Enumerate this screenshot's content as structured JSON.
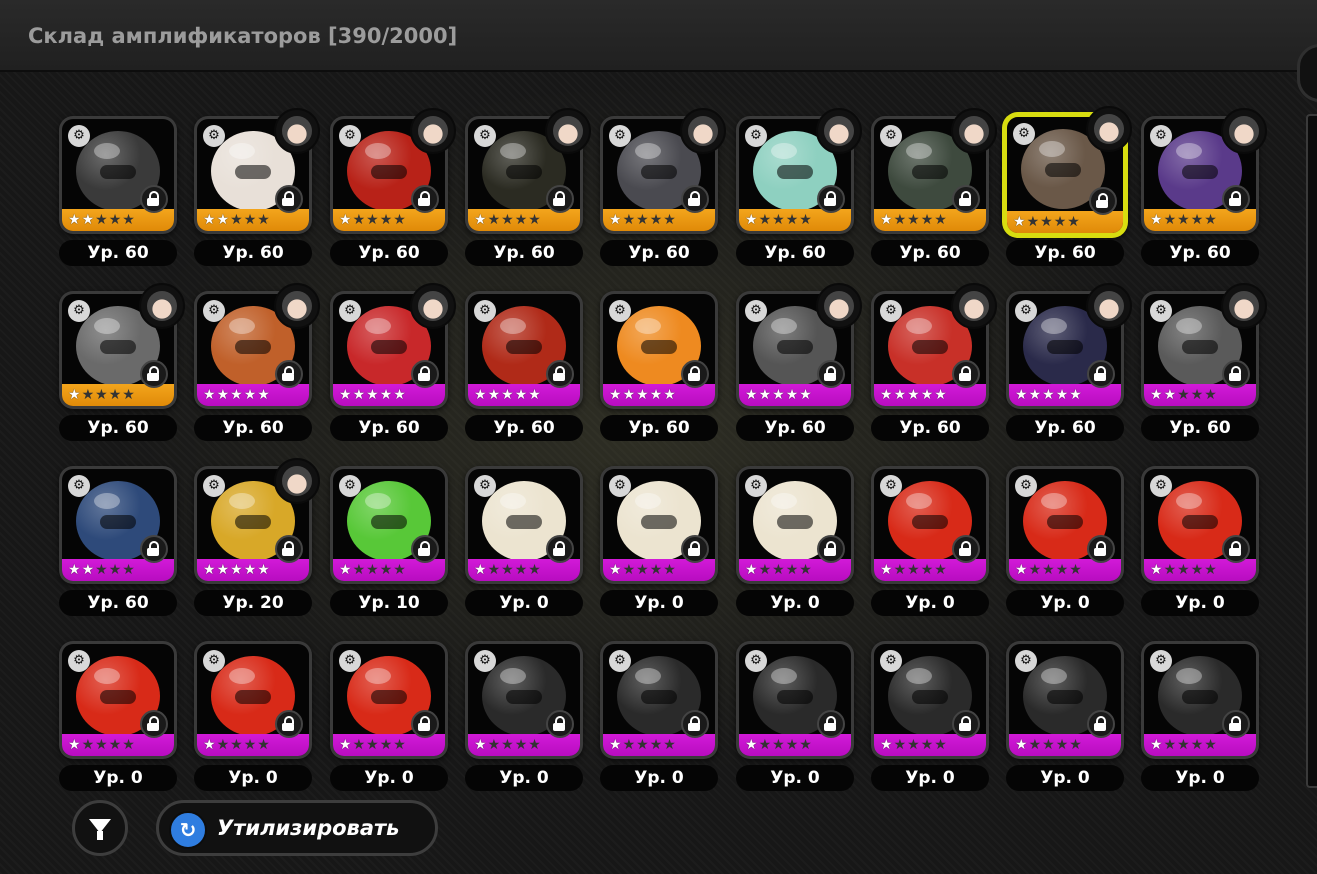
{
  "window": {
    "title": "Склад амплификаторов [390/2000]"
  },
  "grid": {
    "rows": [
      [
        {
          "level": "Ур. 60",
          "stars": 2,
          "rarity": "A",
          "portrait": false,
          "color": "#3a3a3a",
          "selected": false
        },
        {
          "level": "Ур. 60",
          "stars": 2,
          "rarity": "A",
          "portrait": true,
          "color": "#e8e0d8",
          "selected": false
        },
        {
          "level": "Ур. 60",
          "stars": 1,
          "rarity": "A",
          "portrait": true,
          "color": "#b82218",
          "selected": false
        },
        {
          "level": "Ур. 60",
          "stars": 1,
          "rarity": "A",
          "portrait": true,
          "color": "#2b2b22",
          "selected": false
        },
        {
          "level": "Ур. 60",
          "stars": 1,
          "rarity": "A",
          "portrait": true,
          "color": "#4a4a50",
          "selected": false
        },
        {
          "level": "Ур. 60",
          "stars": 1,
          "rarity": "A",
          "portrait": true,
          "color": "#8ed0c0",
          "selected": false
        },
        {
          "level": "Ур. 60",
          "stars": 1,
          "rarity": "A",
          "portrait": true,
          "color": "#3e4a3e",
          "selected": false
        },
        {
          "level": "Ур. 60",
          "stars": 1,
          "rarity": "A",
          "portrait": true,
          "color": "#6a5848",
          "selected": true
        },
        {
          "level": "Ур. 60",
          "stars": 1,
          "rarity": "A",
          "portrait": true,
          "color": "#5a3a8a",
          "selected": false
        }
      ],
      [
        {
          "level": "Ур. 60",
          "stars": 1,
          "rarity": "A",
          "portrait": true,
          "color": "#6a6a6a",
          "selected": false
        },
        {
          "level": "Ур. 60",
          "stars": 5,
          "rarity": "S",
          "portrait": true,
          "color": "#c0602a",
          "selected": false
        },
        {
          "level": "Ур. 60",
          "stars": 5,
          "rarity": "S",
          "portrait": true,
          "color": "#c8282a",
          "selected": false
        },
        {
          "level": "Ур. 60",
          "stars": 5,
          "rarity": "S",
          "portrait": false,
          "color": "#b02a18",
          "selected": false
        },
        {
          "level": "Ур. 60",
          "stars": 5,
          "rarity": "S",
          "portrait": false,
          "color": "#ee8a20",
          "selected": false
        },
        {
          "level": "Ур. 60",
          "stars": 5,
          "rarity": "S",
          "portrait": true,
          "color": "#555555",
          "selected": false
        },
        {
          "level": "Ур. 60",
          "stars": 5,
          "rarity": "S",
          "portrait": true,
          "color": "#c83028",
          "selected": false
        },
        {
          "level": "Ур. 60",
          "stars": 5,
          "rarity": "S",
          "portrait": true,
          "color": "#2a2a4a",
          "selected": false
        },
        {
          "level": "Ур. 60",
          "stars": 2,
          "rarity": "S",
          "portrait": true,
          "color": "#5a5a5a",
          "selected": false
        }
      ],
      [
        {
          "level": "Ур. 60",
          "stars": 2,
          "rarity": "S",
          "portrait": false,
          "color": "#2e4a7a",
          "selected": false
        },
        {
          "level": "Ур. 20",
          "stars": 5,
          "rarity": "S",
          "portrait": true,
          "color": "#d8a828",
          "selected": false
        },
        {
          "level": "Ур. 10",
          "stars": 1,
          "rarity": "S",
          "portrait": false,
          "color": "#58c838",
          "selected": false
        },
        {
          "level": "Ур. 0",
          "stars": 1,
          "rarity": "S",
          "portrait": false,
          "color": "#ece4d0",
          "selected": false
        },
        {
          "level": "Ур. 0",
          "stars": 1,
          "rarity": "S",
          "portrait": false,
          "color": "#ece4d0",
          "selected": false
        },
        {
          "level": "Ур. 0",
          "stars": 1,
          "rarity": "S",
          "portrait": false,
          "color": "#ece4d0",
          "selected": false
        },
        {
          "level": "Ур. 0",
          "stars": 1,
          "rarity": "S",
          "portrait": false,
          "color": "#d82a18",
          "selected": false
        },
        {
          "level": "Ур. 0",
          "stars": 1,
          "rarity": "S",
          "portrait": false,
          "color": "#d82a18",
          "selected": false
        },
        {
          "level": "Ур. 0",
          "stars": 1,
          "rarity": "S",
          "portrait": false,
          "color": "#d82a18",
          "selected": false
        }
      ],
      [
        {
          "level": "Ур. 0",
          "stars": 1,
          "rarity": "S",
          "portrait": false,
          "color": "#d82a18",
          "selected": false
        },
        {
          "level": "Ур. 0",
          "stars": 1,
          "rarity": "S",
          "portrait": false,
          "color": "#d82a18",
          "selected": false
        },
        {
          "level": "Ур. 0",
          "stars": 1,
          "rarity": "S",
          "portrait": false,
          "color": "#d82a18",
          "selected": false
        },
        {
          "level": "Ур. 0",
          "stars": 1,
          "rarity": "S",
          "portrait": false,
          "color": "#2a2a2a",
          "selected": false
        },
        {
          "level": "Ур. 0",
          "stars": 1,
          "rarity": "S",
          "portrait": false,
          "color": "#2a2a2a",
          "selected": false
        },
        {
          "level": "Ур. 0",
          "stars": 1,
          "rarity": "S",
          "portrait": false,
          "color": "#2a2a2a",
          "selected": false
        },
        {
          "level": "Ур. 0",
          "stars": 1,
          "rarity": "S",
          "portrait": false,
          "color": "#2a2a2a",
          "selected": false
        },
        {
          "level": "Ур. 0",
          "stars": 1,
          "rarity": "S",
          "portrait": false,
          "color": "#2a2a2a",
          "selected": false
        },
        {
          "level": "Ур. 0",
          "stars": 1,
          "rarity": "S",
          "portrait": false,
          "color": "#2a2a2a",
          "selected": false
        }
      ]
    ]
  },
  "footer": {
    "filter_icon": "filter-icon",
    "recycle_icon": "recycle-icon",
    "recycle_label": "Утилизировать"
  },
  "colors": {
    "rarity_a": "#f3a51c",
    "rarity_s": "#d21ad8",
    "selection": "#d8dd10",
    "recycle_accent": "#2f7de0"
  }
}
